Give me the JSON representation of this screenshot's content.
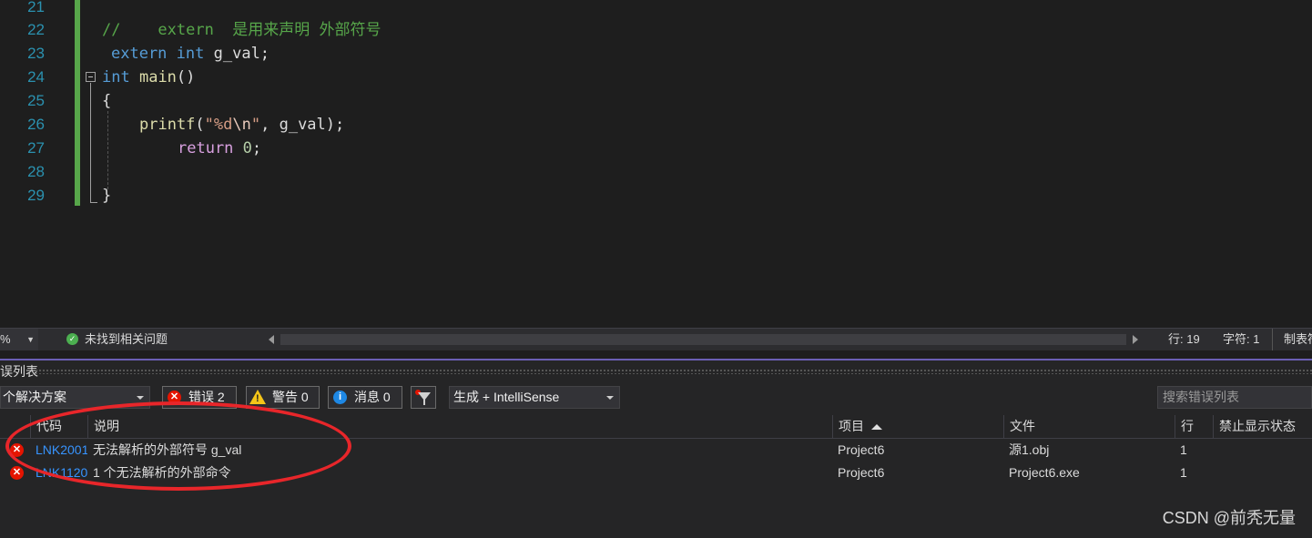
{
  "editor": {
    "lines": [
      {
        "num": "21"
      },
      {
        "num": "22",
        "comment": "//    extern  是用来声明 外部符号"
      },
      {
        "num": "23",
        "kw": "extern",
        "kw2": "int",
        "rest": " g_val;"
      },
      {
        "num": "24",
        "kw": "int",
        "fn": "main",
        "rest": "()"
      },
      {
        "num": "25",
        "rest": "{"
      },
      {
        "num": "26",
        "fn": "printf",
        "open": "(",
        "str_a": "\"%d",
        "esc": "\\n",
        "str_b": "\"",
        "rest": ", g_val);"
      },
      {
        "num": "27",
        "kw": "return",
        "num_val": "0",
        "rest": ";"
      },
      {
        "num": "28"
      },
      {
        "num": "29",
        "rest": "}"
      }
    ]
  },
  "statusbar": {
    "zoom": "%",
    "issues": "未找到相关问题",
    "line": "行: 19",
    "col": "字符: 1",
    "mode": "制表符"
  },
  "error_list": {
    "title": "误列表",
    "scope": "个解决方案",
    "errors_label": "错误 2",
    "warnings_label": "警告 0",
    "messages_label": "消息 0",
    "build_filter": "生成 + IntelliSense",
    "search_placeholder": "搜索错误列表",
    "columns": {
      "code": "代码",
      "desc": "说明",
      "project": "项目",
      "file": "文件",
      "line": "行",
      "suppress": "禁止显示状态"
    },
    "rows": [
      {
        "code": "LNK2001",
        "desc": "无法解析的外部符号 g_val",
        "project": "Project6",
        "file": "源1.obj",
        "line": "1"
      },
      {
        "code": "LNK1120",
        "desc": "1 个无法解析的外部命令",
        "project": "Project6",
        "file": "Project6.exe",
        "line": "1"
      }
    ]
  },
  "icons": {
    "error": "error-icon",
    "warning": "warning-icon",
    "info": "info-icon",
    "filter": "filter-icon",
    "check": "check-icon"
  },
  "colors": {
    "error": "#e51400",
    "link": "#3794ff",
    "annotation": "#e8262a",
    "gutter": "#57a64a"
  },
  "watermark": "CSDN @前秃无量"
}
